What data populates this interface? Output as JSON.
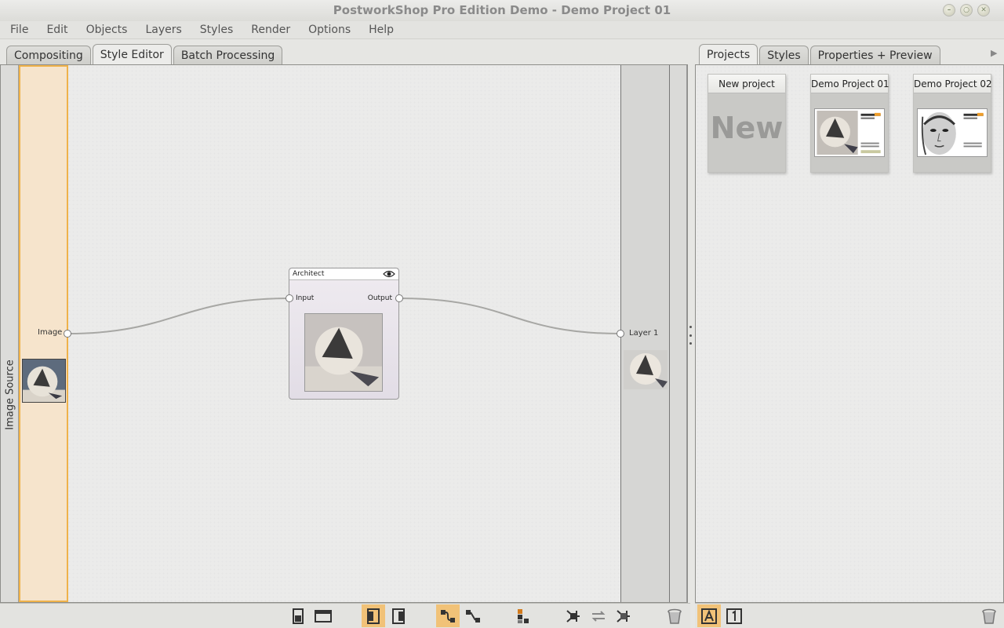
{
  "window": {
    "title": "PostworkShop Pro Edition Demo - Demo Project 01"
  },
  "menu": [
    "File",
    "Edit",
    "Objects",
    "Layers",
    "Styles",
    "Render",
    "Options",
    "Help"
  ],
  "left_tabs": [
    "Compositing",
    "Style Editor",
    "Batch Processing"
  ],
  "left_tabs_active": "Style Editor",
  "right_tabs": [
    "Projects",
    "Styles",
    "Properties + Preview"
  ],
  "right_tabs_active": "Projects",
  "editor": {
    "source_panel_label": "Image Source",
    "source_port_label": "Image",
    "node": {
      "title": "Architect",
      "input_label": "Input",
      "output_label": "Output"
    },
    "layer_port_label": "Layer 1"
  },
  "projects": [
    {
      "title": "New project",
      "type": "new",
      "badge": "New"
    },
    {
      "title": "Demo Project 01",
      "type": "sphere"
    },
    {
      "title": "Demo Project 02",
      "type": "portrait"
    }
  ],
  "toolbar_icons": [
    "panel-compact-icon",
    "panel-wide-icon",
    "align-left-icon",
    "align-right-icon",
    "connect-curved-icon",
    "connect-straight-icon",
    "node-stack-icon",
    "branch-add-icon",
    "swap-icon",
    "branch-remove-icon",
    "trash-icon"
  ],
  "right_toolbar_icons": [
    "text-mode-icon",
    "number-mode-icon",
    "trash-icon"
  ],
  "colors": {
    "accent": "#efb24a",
    "source_fill": "#f6e4cc",
    "toggle_on": "#f1c278"
  }
}
